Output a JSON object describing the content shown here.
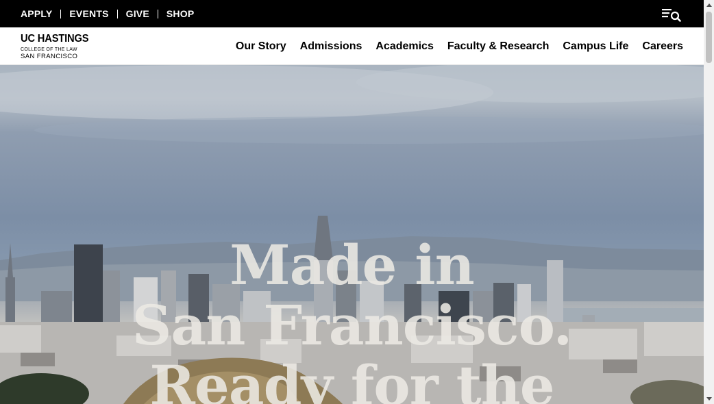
{
  "utility_bar": {
    "links": [
      "APPLY",
      "EVENTS",
      "GIVE",
      "SHOP"
    ],
    "menu_search_icon": "menu-search-icon"
  },
  "logo": {
    "line1": "UC HASTINGS",
    "line2": "COLLEGE OF THE LAW",
    "line3": "SAN FRANCISCO"
  },
  "nav": {
    "items": [
      "Our Story",
      "Admissions",
      "Academics",
      "Faculty & Research",
      "Campus Life",
      "Careers"
    ]
  },
  "hero": {
    "headline_lines": [
      "Made in",
      "San Francisco.",
      "Ready for the"
    ]
  },
  "colors": {
    "utility_bar_bg": "#000000",
    "nav_bg": "#ffffff",
    "text_dark": "#000000"
  }
}
